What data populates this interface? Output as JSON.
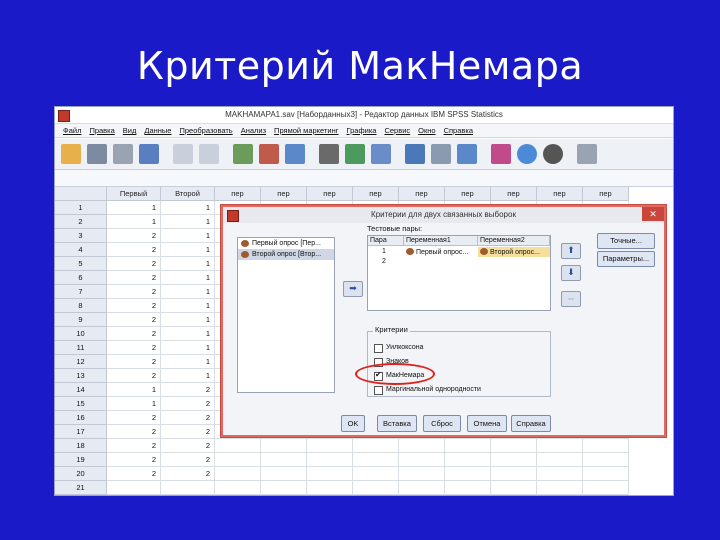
{
  "slide": {
    "title": "Критерий МакНемара"
  },
  "window": {
    "title": "MAKHAMAPA1.sav [Наборданных3] - Редактор данных IBM SPSS Statistics"
  },
  "menu": [
    "Файл",
    "Правка",
    "Вид",
    "Данные",
    "Преобразовать",
    "Анализ",
    "Прямой маркетинг",
    "Графика",
    "Сервис",
    "Окно",
    "Справка"
  ],
  "grid": {
    "columns": [
      "Первый",
      "Второй",
      "пер",
      "пер",
      "пер",
      "пер",
      "пер",
      "пер",
      "пер",
      "пер",
      "пер"
    ],
    "rows": [
      {
        "n": "1",
        "a": "1",
        "b": "1"
      },
      {
        "n": "2",
        "a": "1",
        "b": "1"
      },
      {
        "n": "3",
        "a": "2",
        "b": "1"
      },
      {
        "n": "4",
        "a": "2",
        "b": "1"
      },
      {
        "n": "5",
        "a": "2",
        "b": "1"
      },
      {
        "n": "6",
        "a": "2",
        "b": "1"
      },
      {
        "n": "7",
        "a": "2",
        "b": "1"
      },
      {
        "n": "8",
        "a": "2",
        "b": "1"
      },
      {
        "n": "9",
        "a": "2",
        "b": "1"
      },
      {
        "n": "10",
        "a": "2",
        "b": "1"
      },
      {
        "n": "11",
        "a": "2",
        "b": "1"
      },
      {
        "n": "12",
        "a": "2",
        "b": "1"
      },
      {
        "n": "13",
        "a": "2",
        "b": "1"
      },
      {
        "n": "14",
        "a": "1",
        "b": "2"
      },
      {
        "n": "15",
        "a": "1",
        "b": "2"
      },
      {
        "n": "16",
        "a": "2",
        "b": "2"
      },
      {
        "n": "17",
        "a": "2",
        "b": "2"
      },
      {
        "n": "18",
        "a": "2",
        "b": "2"
      },
      {
        "n": "19",
        "a": "2",
        "b": "2"
      },
      {
        "n": "20",
        "a": "2",
        "b": "2"
      },
      {
        "n": "21",
        "a": "",
        "b": ""
      }
    ]
  },
  "dialog": {
    "title": "Критерии для двух связанных выборок",
    "variables": [
      "Первый опрос [Пер...",
      "Второй опрос [Втор..."
    ],
    "pairs_label": "Тестовые пары:",
    "pairs_headers": [
      "Пара",
      "Переменная1",
      "Переменная2"
    ],
    "pairs_rows": [
      {
        "pair": "1",
        "var1": "Первый опрос...",
        "var2": "Второй опрос..."
      },
      {
        "pair": "2",
        "var1": "",
        "var2": ""
      }
    ],
    "criteria_label": "Критерии",
    "criteria": [
      {
        "label": "Уилкоксона",
        "checked": false
      },
      {
        "label": "Знаков",
        "checked": false
      },
      {
        "label": "МакНемара",
        "checked": true
      },
      {
        "label": "Маргинальной однородности",
        "checked": false
      }
    ],
    "side_buttons": [
      "Точные...",
      "Параметры..."
    ],
    "buttons": [
      "OK",
      "Вставка",
      "Сброс",
      "Отмена",
      "Справка"
    ]
  },
  "colors": {
    "slide_bg": "#1a1ac8",
    "highlight": "#e0201a",
    "dialog_border": "#e06a60"
  }
}
